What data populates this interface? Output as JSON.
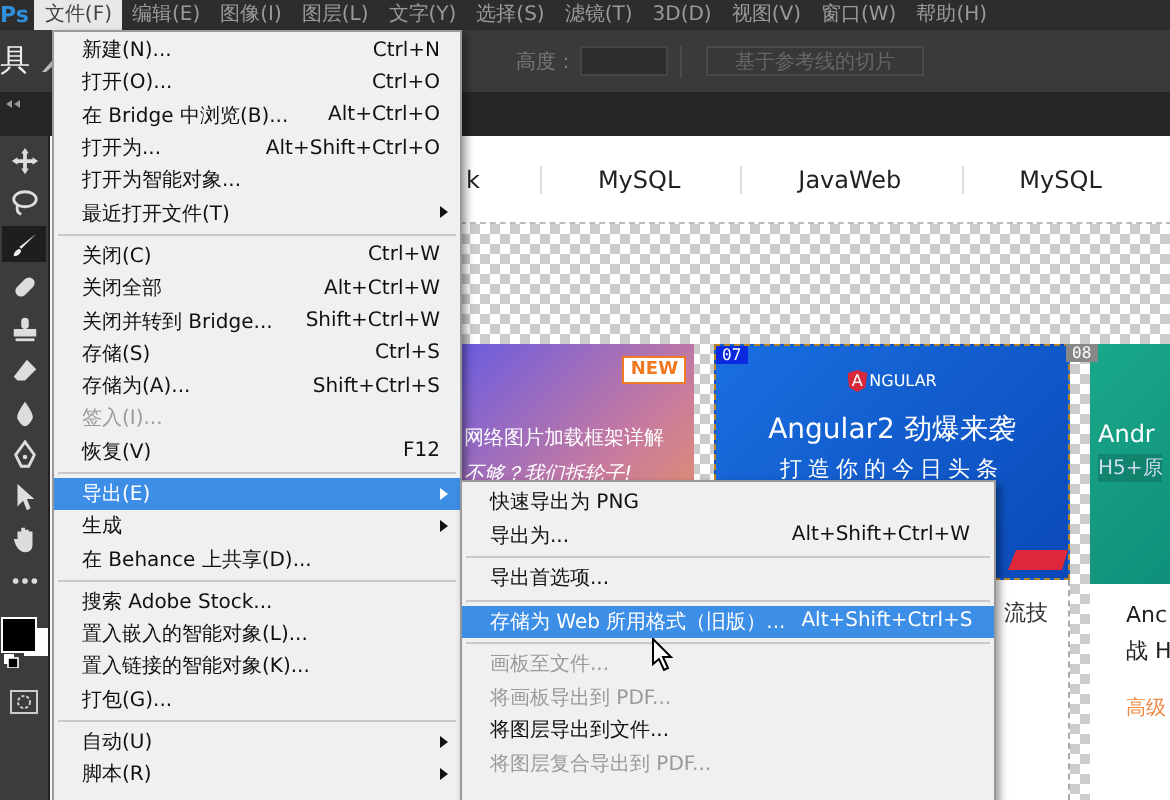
{
  "app": {
    "logo": "Ps"
  },
  "menubar": [
    {
      "label": "文件(F)",
      "selected": true
    },
    {
      "label": "编辑(E)",
      "selected": false
    },
    {
      "label": "图像(I)",
      "selected": false
    },
    {
      "label": "图层(L)",
      "selected": false
    },
    {
      "label": "文字(Y)",
      "selected": false
    },
    {
      "label": "选择(S)",
      "selected": false
    },
    {
      "label": "滤镜(T)",
      "selected": false
    },
    {
      "label": "3D(D)",
      "selected": false
    },
    {
      "label": "视图(V)",
      "selected": false
    },
    {
      "label": "窗口(W)",
      "selected": false
    },
    {
      "label": "帮助(H)",
      "selected": false
    }
  ],
  "options_bar": {
    "tool_label": "具",
    "height_label": "高度：",
    "button": "基于参考线的切片"
  },
  "tools": [
    {
      "kind": "move",
      "selected": false
    },
    {
      "kind": "lasso",
      "selected": false
    },
    {
      "kind": "brush",
      "selected": true
    },
    {
      "kind": "bandage",
      "selected": false
    },
    {
      "kind": "stamp",
      "selected": false
    },
    {
      "kind": "eraser",
      "selected": false
    },
    {
      "kind": "drop",
      "selected": false
    },
    {
      "kind": "pen",
      "selected": false
    },
    {
      "kind": "arrow",
      "selected": false
    },
    {
      "kind": "hand",
      "selected": false
    },
    {
      "kind": "dots",
      "selected": false
    }
  ],
  "file_menu": [
    {
      "kind": "item",
      "label": "新建(N)...",
      "shortcut": "Ctrl+N",
      "disabled": false,
      "selected": false,
      "submenu": false
    },
    {
      "kind": "item",
      "label": "打开(O)...",
      "shortcut": "Ctrl+O",
      "disabled": false,
      "selected": false,
      "submenu": false
    },
    {
      "kind": "item",
      "label": "在 Bridge 中浏览(B)...",
      "shortcut": "Alt+Ctrl+O",
      "disabled": false,
      "selected": false,
      "submenu": false
    },
    {
      "kind": "item",
      "label": "打开为...",
      "shortcut": "Alt+Shift+Ctrl+O",
      "disabled": false,
      "selected": false,
      "submenu": false
    },
    {
      "kind": "item",
      "label": "打开为智能对象...",
      "disabled": false,
      "selected": false,
      "submenu": false
    },
    {
      "kind": "item",
      "label": "最近打开文件(T)",
      "disabled": false,
      "selected": false,
      "submenu": true
    },
    {
      "kind": "separator"
    },
    {
      "kind": "item",
      "label": "关闭(C)",
      "shortcut": "Ctrl+W",
      "disabled": false,
      "selected": false,
      "submenu": false
    },
    {
      "kind": "item",
      "label": "关闭全部",
      "shortcut": "Alt+Ctrl+W",
      "disabled": false,
      "selected": false,
      "submenu": false
    },
    {
      "kind": "item",
      "label": "关闭并转到 Bridge...",
      "shortcut": "Shift+Ctrl+W",
      "disabled": false,
      "selected": false,
      "submenu": false
    },
    {
      "kind": "item",
      "label": "存储(S)",
      "shortcut": "Ctrl+S",
      "disabled": false,
      "selected": false,
      "submenu": false
    },
    {
      "kind": "item",
      "label": "存储为(A)...",
      "shortcut": "Shift+Ctrl+S",
      "disabled": false,
      "selected": false,
      "submenu": false
    },
    {
      "kind": "item",
      "label": "签入(I)...",
      "disabled": true,
      "selected": false,
      "submenu": false
    },
    {
      "kind": "item",
      "label": "恢复(V)",
      "shortcut": "F12",
      "disabled": false,
      "selected": false,
      "submenu": false
    },
    {
      "kind": "separator"
    },
    {
      "kind": "item",
      "label": "导出(E)",
      "disabled": false,
      "selected": true,
      "submenu": true
    },
    {
      "kind": "item",
      "label": "生成",
      "disabled": false,
      "selected": false,
      "submenu": true
    },
    {
      "kind": "item",
      "label": "在 Behance 上共享(D)...",
      "disabled": false,
      "selected": false,
      "submenu": false
    },
    {
      "kind": "separator"
    },
    {
      "kind": "item",
      "label": "搜索 Adobe Stock...",
      "disabled": false,
      "selected": false,
      "submenu": false
    },
    {
      "kind": "item",
      "label": "置入嵌入的智能对象(L)...",
      "disabled": false,
      "selected": false,
      "submenu": false
    },
    {
      "kind": "item",
      "label": "置入链接的智能对象(K)...",
      "disabled": false,
      "selected": false,
      "submenu": false
    },
    {
      "kind": "item",
      "label": "打包(G)...",
      "disabled": false,
      "selected": false,
      "submenu": false
    },
    {
      "kind": "separator"
    },
    {
      "kind": "item",
      "label": "自动(U)",
      "disabled": false,
      "selected": false,
      "submenu": true
    },
    {
      "kind": "item",
      "label": "脚本(R)",
      "disabled": false,
      "selected": false,
      "submenu": true
    }
  ],
  "export_submenu": [
    {
      "kind": "item",
      "label": "快速导出为 PNG",
      "disabled": false,
      "selected": false
    },
    {
      "kind": "item",
      "label": "导出为...",
      "shortcut": "Alt+Shift+Ctrl+W",
      "disabled": false,
      "selected": false
    },
    {
      "kind": "separator"
    },
    {
      "kind": "item",
      "label": "导出首选项...",
      "disabled": false,
      "selected": false
    },
    {
      "kind": "separator"
    },
    {
      "kind": "item",
      "label": "存储为 Web 所用格式（旧版）...",
      "shortcut": "Alt+Shift+Ctrl+S",
      "disabled": false,
      "selected": true
    },
    {
      "kind": "separator"
    },
    {
      "kind": "item",
      "label": "画板至文件...",
      "disabled": true,
      "selected": false
    },
    {
      "kind": "item",
      "label": "将画板导出到 PDF...",
      "disabled": true,
      "selected": false
    },
    {
      "kind": "item",
      "label": "将图层导出到文件...",
      "disabled": false,
      "selected": false
    },
    {
      "kind": "item",
      "label": "将图层复合导出到 PDF...",
      "disabled": true,
      "selected": false
    }
  ],
  "nav": [
    "k",
    "MySQL",
    "JavaWeb",
    "MySQL"
  ],
  "cards": [
    {
      "kind": "gradient",
      "badge": "NEW",
      "title": "网络图片加载框架详解",
      "subtitle": "不够？我们拆轮子!"
    },
    {
      "kind": "angular",
      "slice": "07",
      "logo_mark": "A",
      "logo_text": "NGULAR",
      "title": "Angular2 劲爆来袭",
      "subtitle": "打造你的今日头条",
      "caption": "流技"
    },
    {
      "kind": "green",
      "slice": "08",
      "title": "Andr",
      "subtitle": "H5+原",
      "caption_lines": [
        "Anc",
        "战 H"
      ],
      "level_label": "高级"
    }
  ]
}
